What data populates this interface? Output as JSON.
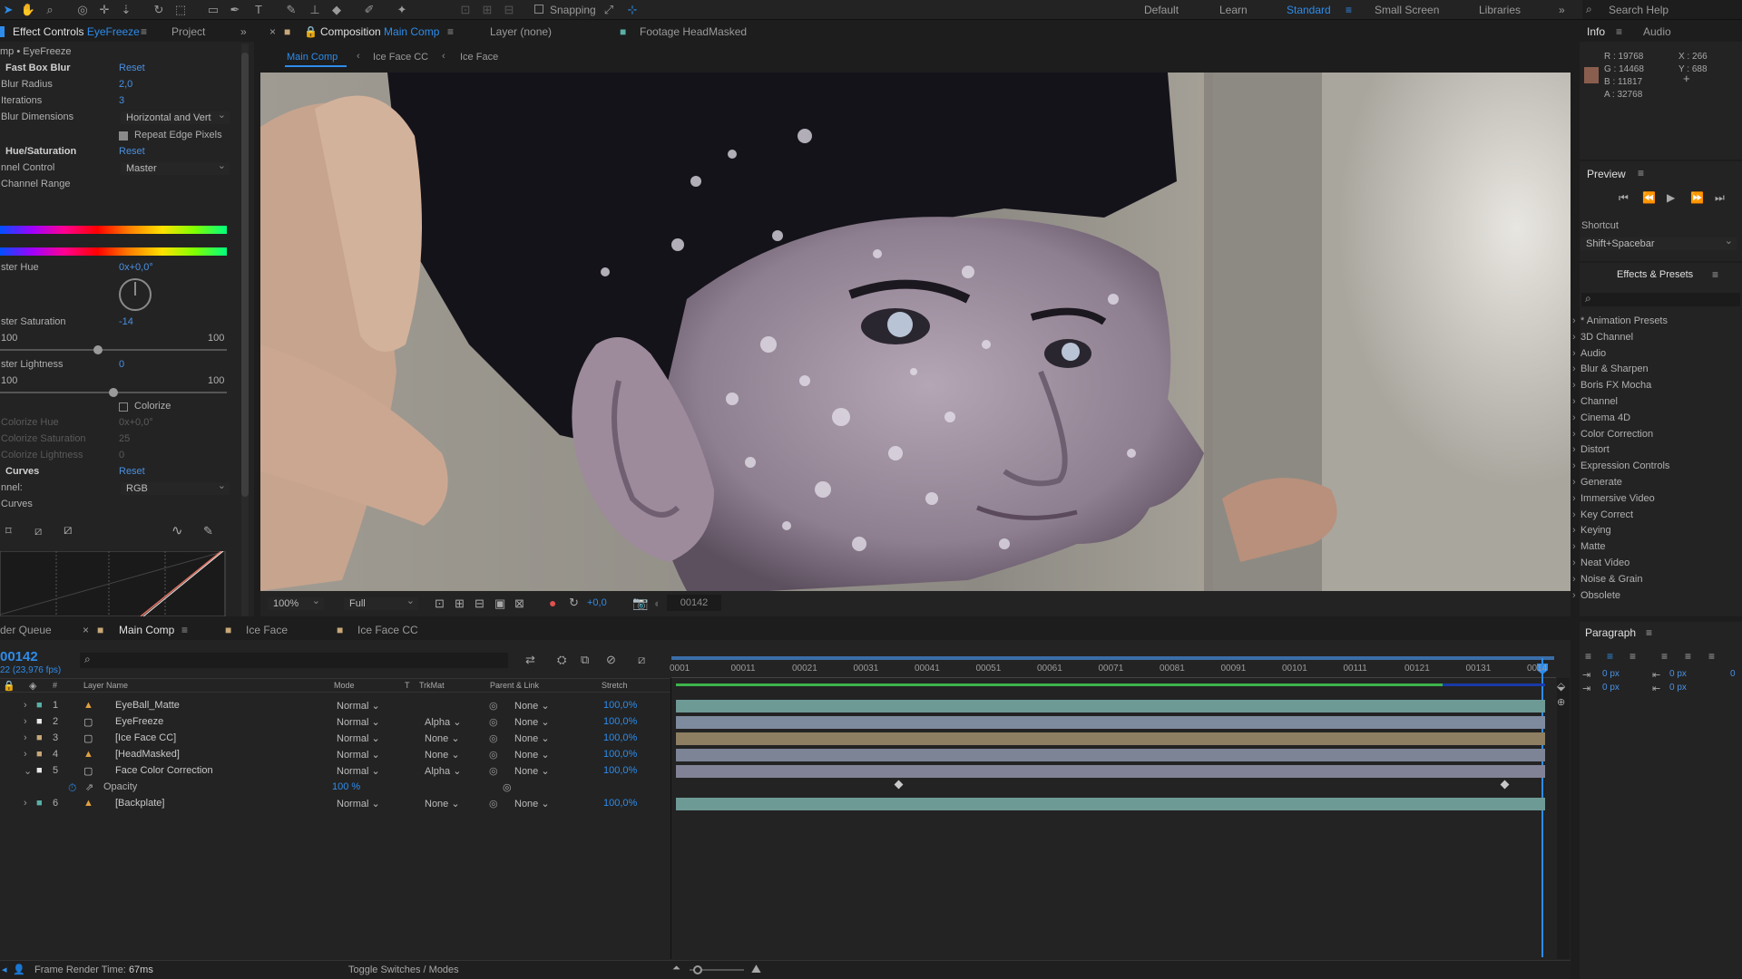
{
  "toolbar": {
    "snapping_label": "Snapping",
    "workspaces": [
      "Default",
      "Learn",
      "Standard",
      "Small Screen",
      "Libraries"
    ],
    "active_workspace": "Standard",
    "search_placeholder": "Search Help"
  },
  "effect_controls": {
    "tab_label": "Effect Controls",
    "tab_layer": "EyeFreeze",
    "project_tab": "Project",
    "breadcrumb": "mp • EyeFreeze",
    "fast_box_blur": {
      "name": "Fast Box Blur",
      "reset": "Reset",
      "blur_radius_label": "Blur Radius",
      "blur_radius_value": "2,0",
      "iterations_label": "Iterations",
      "iterations_value": "3",
      "blur_dimensions_label": "Blur Dimensions",
      "blur_dimensions_value": "Horizontal and Vert",
      "repeat_edge_label": "Repeat Edge Pixels"
    },
    "hue_saturation": {
      "name": "Hue/Saturation",
      "reset": "Reset",
      "channel_control_label": "nnel Control",
      "channel_control_value": "Master",
      "channel_range_label": "Channel Range",
      "master_hue_label": "ster Hue",
      "master_hue_value": "0x+0,0°",
      "master_saturation_label": "ster Saturation",
      "master_saturation_value": "-14",
      "sat_min": "100",
      "sat_max": "100",
      "sat_fraction": 0.43,
      "master_lightness_label": "ster Lightness",
      "master_lightness_value": "0",
      "light_min": "100",
      "light_max": "100",
      "light_fraction": 0.5,
      "colorize_label": "Colorize",
      "colorize_hue_label": "Colorize Hue",
      "colorize_hue_value": "0x+0,0°",
      "colorize_saturation_label": "Colorize Saturation",
      "colorize_saturation_value": "25",
      "colorize_lightness_label": "Colorize Lightness",
      "colorize_lightness_value": "0"
    },
    "curves": {
      "name": "Curves",
      "reset": "Reset",
      "channel_label": "nnel:",
      "channel_value": "RGB",
      "curves_label": "Curves"
    }
  },
  "composition": {
    "panel_label": "Composition",
    "comp_name": "Main Comp",
    "layer_label": "Layer (none)",
    "footage_label": "Footage",
    "footage_name": "HeadMasked",
    "nav_tabs": [
      "Main Comp",
      "Ice Face CC",
      "Ice Face"
    ],
    "zoom": "100%",
    "resolution": "Full",
    "exposure": "+0,0",
    "timecode": "00142"
  },
  "info": {
    "tab": "Info",
    "audio_tab": "Audio",
    "r": "R : 19768",
    "g": "G : 14468",
    "b": "B : 11817",
    "a": "A : 32768",
    "x": "X : 266",
    "y": "Y : 688",
    "swatch_color": "#8a5e4e"
  },
  "preview": {
    "title": "Preview",
    "shortcut_label": "Shortcut",
    "shortcut_value": "Shift+Spacebar"
  },
  "effects_presets": {
    "title": "Effects & Presets",
    "items": [
      "* Animation Presets",
      "3D Channel",
      "Audio",
      "Blur & Sharpen",
      "Boris FX Mocha",
      "Channel",
      "Cinema 4D",
      "Color Correction",
      "Distort",
      "Expression Controls",
      "Generate",
      "Immersive Video",
      "Key Correct",
      "Keying",
      "Matte",
      "Neat Video",
      "Noise & Grain",
      "Obsolete"
    ]
  },
  "paragraph": {
    "title": "Paragraph",
    "indent_values": [
      "0 px",
      "0 px",
      "0 px",
      "0 px",
      "0"
    ]
  },
  "timeline": {
    "tabs": [
      "der Queue",
      "Main Comp",
      "Ice Face",
      "Ice Face CC"
    ],
    "current_time": "00142",
    "fps_label": "22 (23,976 fps)",
    "columns": [
      "Layer Name",
      "Mode",
      "T",
      "TrkMat",
      "Parent & Link",
      "Stretch"
    ],
    "ruler_marks": [
      "0001",
      "00011",
      "00021",
      "00031",
      "00041",
      "00051",
      "00061",
      "00071",
      "00081",
      "00091",
      "00101",
      "00111",
      "00121",
      "00131",
      "0014"
    ],
    "layers": [
      {
        "num": "1",
        "name": "EyeBall_Matte",
        "mode": "Normal",
        "trkmat": "",
        "parent": "None",
        "stretch": "100,0%",
        "label_color": "#5ab0a8",
        "bar_color": "#6e9a96"
      },
      {
        "num": "2",
        "name": "EyeFreeze",
        "mode": "Normal",
        "trkmat": "Alpha",
        "parent": "None",
        "stretch": "100,0%",
        "label_color": "#e8e8e8",
        "bar_color": "#7e8a9e"
      },
      {
        "num": "3",
        "name": "[Ice Face CC]",
        "mode": "Normal",
        "trkmat": "None",
        "parent": "None",
        "stretch": "100,0%",
        "label_color": "#c8a878",
        "bar_color": "#8e7e62"
      },
      {
        "num": "4",
        "name": "[HeadMasked]",
        "mode": "Normal",
        "trkmat": "None",
        "parent": "None",
        "stretch": "100,0%",
        "label_color": "#c8a878",
        "bar_color": "#7c8496"
      },
      {
        "num": "5",
        "name": "Face Color Correction",
        "mode": "Normal",
        "trkmat": "Alpha",
        "parent": "None",
        "stretch": "100,0%",
        "label_color": "#e8e8e8",
        "bar_color": "#828296"
      },
      {
        "num": "6",
        "name": "[Backplate]",
        "mode": "Normal",
        "trkmat": "None",
        "parent": "None",
        "stretch": "100,0%",
        "label_color": "#5ab0a8",
        "bar_color": "#6e9a96"
      }
    ],
    "opacity_label": "Opacity",
    "opacity_value": "100 %"
  },
  "status": {
    "frame_render_label": "Frame Render Time:",
    "frame_render_value": "67ms",
    "toggle_label": "Toggle Switches / Modes"
  }
}
